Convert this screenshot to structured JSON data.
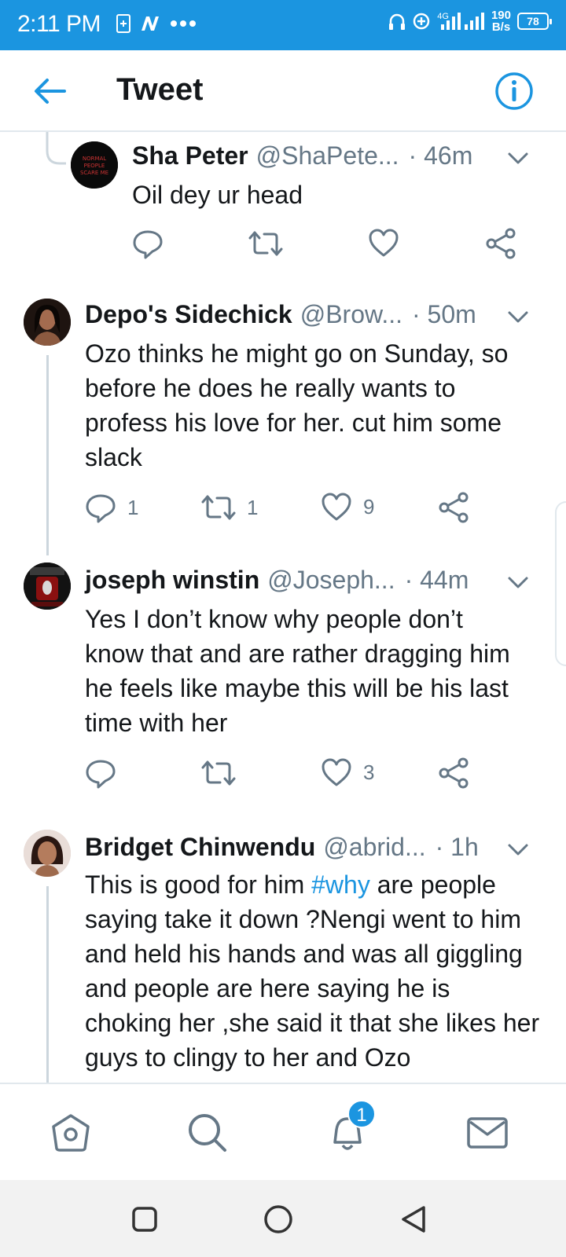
{
  "status_bar": {
    "time": "2:11 PM",
    "network": "4G",
    "speed_value": "190",
    "speed_unit": "B/s",
    "battery": "78"
  },
  "header": {
    "title": "Tweet",
    "back_icon": "arrow-left-icon",
    "info_icon": "info-icon"
  },
  "tweets": [
    {
      "name": "Sha Peter",
      "handle": "@ShaPete...",
      "time": "· 46m",
      "text": "Oil dey ur head",
      "replies": "",
      "retweets": "",
      "likes": ""
    },
    {
      "name": "Depo's Sidechick",
      "handle": "@Brow...",
      "time": "· 50m",
      "text": "Ozo thinks he might go on Sunday, so before he does he really wants to profess his love for her. cut him some slack",
      "replies": "1",
      "retweets": "1",
      "likes": "9"
    },
    {
      "name": "joseph winstin",
      "handle": "@Joseph...",
      "time": "· 44m",
      "text": "Yes I don’t know why people don’t know that and are rather dragging him he feels like maybe this will be his last time with her",
      "replies": "",
      "retweets": "",
      "likes": "3"
    },
    {
      "name": "Bridget Chinwendu",
      "handle": "@abrid...",
      "time": "· 1h",
      "text_before": "This is good for him ",
      "hashtag": "#why",
      "text_after": " are people saying take it down ?Nengi went to him and held his hands and was all giggling and people are here saying he is choking her ,she said it that she likes her guys to clingy to her and Ozo"
    }
  ],
  "bottom_nav": {
    "items": [
      "home-icon",
      "search-icon",
      "notifications-icon",
      "messages-icon"
    ],
    "notification_badge": "1"
  },
  "colors": {
    "accent": "#1b95e0",
    "text": "#14171a",
    "secondary": "#657786",
    "divider": "#e1e8ed"
  }
}
